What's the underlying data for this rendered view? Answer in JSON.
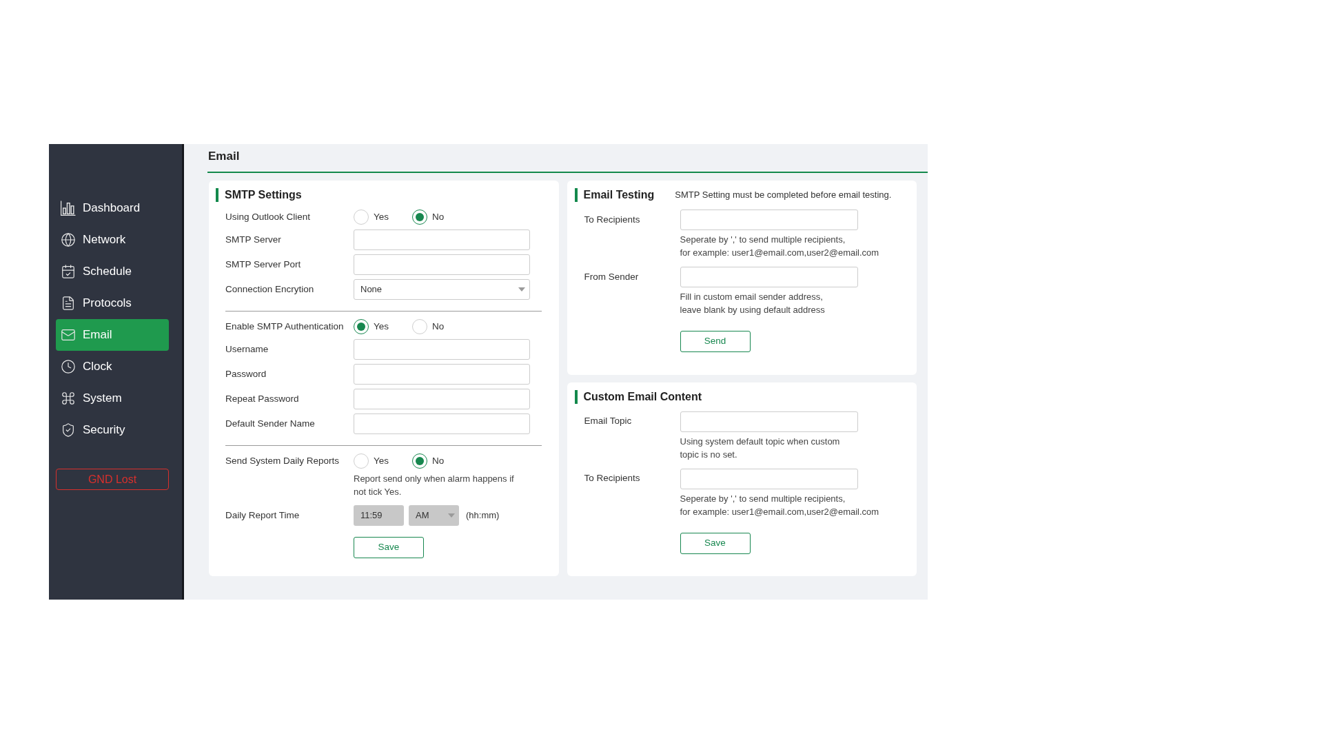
{
  "sidebar": {
    "items": [
      {
        "label": "Dashboard",
        "selected": false
      },
      {
        "label": "Network",
        "selected": false
      },
      {
        "label": "Schedule",
        "selected": false
      },
      {
        "label": "Protocols",
        "selected": false
      },
      {
        "label": "Email",
        "selected": true
      },
      {
        "label": "Clock",
        "selected": false
      },
      {
        "label": "System",
        "selected": false
      },
      {
        "label": "Security",
        "selected": false
      }
    ],
    "status_button": {
      "label": "GND Lost"
    }
  },
  "page": {
    "title": "Email"
  },
  "smtp_settings": {
    "title": "SMTP Settings",
    "sections": [
      {
        "rows": [
          {
            "kind": "radio",
            "label": "Using Outlook Client",
            "options": [
              {
                "label": "Yes",
                "selected": false
              },
              {
                "label": "No",
                "selected": true
              }
            ]
          },
          {
            "kind": "input",
            "label": "SMTP Server"
          },
          {
            "kind": "input",
            "label": "SMTP Server Port"
          },
          {
            "kind": "select",
            "label": "Connection Encrytion",
            "value": "None"
          }
        ]
      },
      {
        "rows": [
          {
            "kind": "radio",
            "label": "Enable SMTP Authentication",
            "options": [
              {
                "label": "Yes",
                "selected": true
              },
              {
                "label": "No",
                "selected": false
              }
            ]
          },
          {
            "kind": "input",
            "label": "Username"
          },
          {
            "kind": "input",
            "label": "Password"
          },
          {
            "kind": "input",
            "label": "Repeat Password"
          },
          {
            "kind": "input",
            "label": "Default Sender Name"
          }
        ]
      },
      {
        "rows": [
          {
            "kind": "radio",
            "label": "Send System Daily Reports",
            "options": [
              {
                "label": "Yes",
                "selected": false
              },
              {
                "label": "No",
                "selected": true
              }
            ],
            "hint": [
              "Report send only when alarm happens if",
              "not tick Yes."
            ]
          },
          {
            "kind": "time",
            "label": "Daily Report Time",
            "value": "11:59",
            "period": "AM",
            "unit": "(hh:mm)",
            "disabled": true
          }
        ]
      }
    ],
    "save_button": {
      "label": "Save"
    }
  },
  "email_testing": {
    "title": "Email Testing",
    "note": "SMTP Setting must be completed before email testing.",
    "fields": [
      {
        "label": "To Recipients",
        "hint": [
          "Seperate by ',' to send multiple recipients,",
          "for example: user1@email.com,user2@email.com"
        ]
      },
      {
        "label": "From Sender",
        "hint": [
          "Fill in custom email sender address,",
          "leave blank by using default address"
        ]
      }
    ],
    "send_button": {
      "label": "Send"
    }
  },
  "custom_email_content": {
    "title": "Custom Email Content",
    "fields": [
      {
        "label": "Email Topic",
        "hint": [
          "Using system default topic when custom",
          "topic is no set."
        ]
      },
      {
        "label": "To Recipients",
        "hint": [
          "Seperate by ',' to send multiple recipients,",
          "for example: user1@email.com,user2@email.com"
        ]
      }
    ],
    "save_button": {
      "label": "Save"
    }
  }
}
